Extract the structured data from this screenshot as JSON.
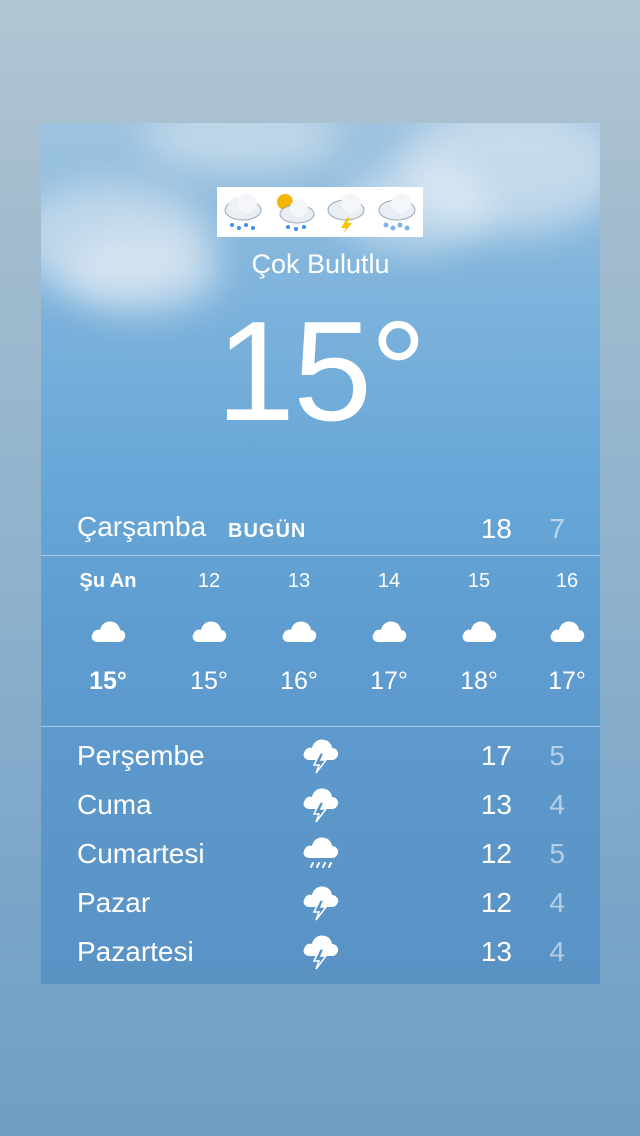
{
  "header": {
    "emoji_icons": [
      "cloud-rain-icon",
      "sun-behind-rain-cloud-icon",
      "cloud-lightning-icon",
      "cloud-snow-icon"
    ],
    "condition": "Çok Bulutlu",
    "temperature": "15°"
  },
  "today": {
    "day": "Çarşamba",
    "badge": "BUGÜN",
    "high": "18",
    "low": "7"
  },
  "hourly": [
    {
      "time": "Şu An",
      "icon": "cloud-icon",
      "temp": "15°"
    },
    {
      "time": "12",
      "icon": "cloud-icon",
      "temp": "15°"
    },
    {
      "time": "13",
      "icon": "cloud-icon",
      "temp": "16°"
    },
    {
      "time": "14",
      "icon": "cloud-icon",
      "temp": "17°"
    },
    {
      "time": "15",
      "icon": "cloud-icon",
      "temp": "18°"
    },
    {
      "time": "16",
      "icon": "cloud-icon",
      "temp": "17°"
    }
  ],
  "daily": [
    {
      "day": "Perşembe",
      "icon": "thunderstorm-icon",
      "high": "17",
      "low": "5"
    },
    {
      "day": "Cuma",
      "icon": "thunderstorm-icon",
      "high": "13",
      "low": "4"
    },
    {
      "day": "Cumartesi",
      "icon": "rain-icon",
      "high": "12",
      "low": "5"
    },
    {
      "day": "Pazar",
      "icon": "thunderstorm-icon",
      "high": "12",
      "low": "4"
    },
    {
      "day": "Pazartesi",
      "icon": "thunderstorm-icon",
      "high": "13",
      "low": "4"
    }
  ],
  "colors": {
    "text": "#ffffff",
    "low_temp": "#c6dcee",
    "card_top": "#9ec3e0",
    "card_bottom": "#5a92c4"
  }
}
